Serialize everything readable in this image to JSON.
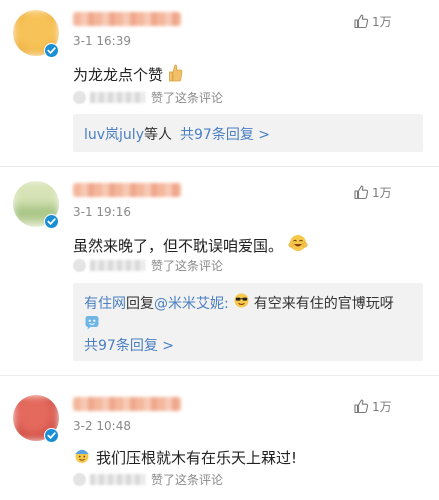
{
  "comments": [
    {
      "time": "3-1 16:39",
      "like_count": "1万",
      "text": "为龙龙点个赞",
      "liked_label": "赞了这条评论",
      "reply_preview": {
        "users": "luv岚july",
        "suffix": "等人",
        "reply_count": "共97条回复 >"
      }
    },
    {
      "time": "3-1 19:16",
      "like_count": "1万",
      "text": "虽然来晚了，但不耽误咱爱国。",
      "liked_label": "赞了这条评论",
      "reply_preview": {
        "author": "有住网",
        "reply_word": "回复",
        "mention": "@米米艾妮:",
        "reply_text": "有空来有住的官博玩呀",
        "reply_count": "共97条回复 >"
      }
    },
    {
      "time": "3-2 10:48",
      "like_count": "1万",
      "text": "我们压根就木有在乐天上槑过!",
      "liked_label": "赞了这条评论"
    }
  ],
  "icons": {
    "verified": "verified-badge-icon",
    "like": "thumbs-up-icon"
  },
  "colors": {
    "link": "#4a7fc1",
    "badge": "#1a8fd6",
    "reply_bg": "#f2f2f2"
  }
}
